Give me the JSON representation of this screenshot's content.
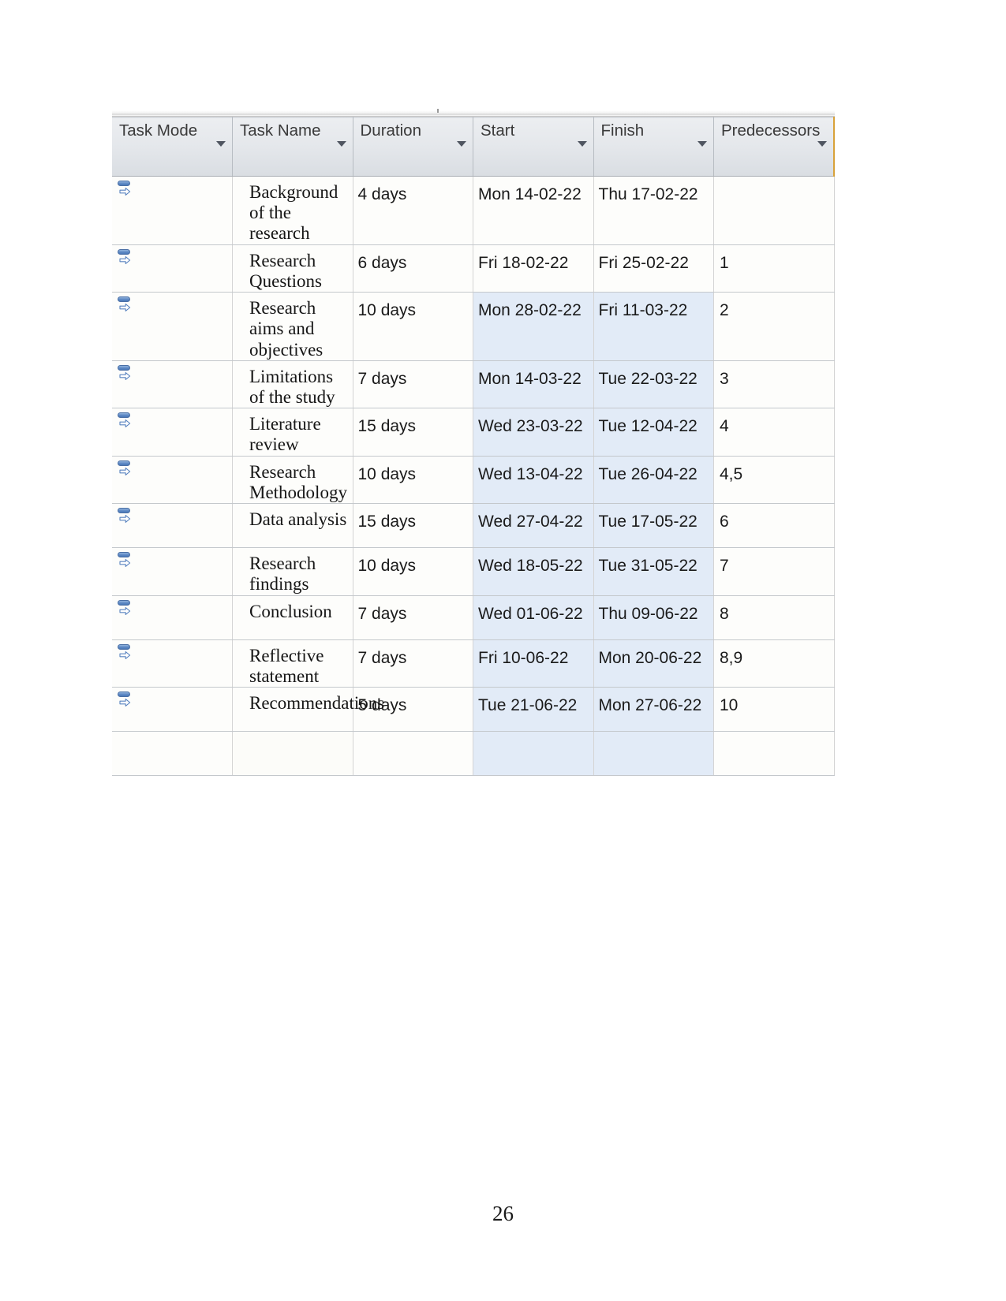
{
  "document": {
    "page_number": "26"
  },
  "grid": {
    "columns": [
      {
        "key": "task_mode",
        "label": "Task Mode",
        "has_filter_arrow": true
      },
      {
        "key": "task_name",
        "label": "Task Name",
        "has_filter_arrow": true
      },
      {
        "key": "duration",
        "label": "Duration",
        "has_filter_arrow": true
      },
      {
        "key": "start",
        "label": "Start",
        "has_filter_arrow": true
      },
      {
        "key": "finish",
        "label": "Finish",
        "has_filter_arrow": true
      },
      {
        "key": "predecessors",
        "label": "Predecessors",
        "has_filter_arrow": true
      }
    ],
    "task_mode_icon": "manually-scheduled-icon",
    "highlight_color": "#e2ebf7",
    "header_accent_color": "#d8a23a",
    "rows": [
      {
        "task_mode_icon": "manually-scheduled-icon",
        "task_name": "Background of the research",
        "duration": "4 days",
        "start": "Mon 14-02-22",
        "finish": "Thu 17-02-22",
        "predecessors": "",
        "highlighted": false
      },
      {
        "task_mode_icon": "manually-scheduled-icon",
        "task_name": "Research Questions",
        "duration": "6 days",
        "start": "Fri 18-02-22",
        "finish": "Fri 25-02-22",
        "predecessors": "1",
        "highlighted": false
      },
      {
        "task_mode_icon": "manually-scheduled-icon",
        "task_name": "Research aims and objectives",
        "duration": "10 days",
        "start": "Mon 28-02-22",
        "finish": "Fri 11-03-22",
        "predecessors": "2",
        "highlighted": true
      },
      {
        "task_mode_icon": "manually-scheduled-icon",
        "task_name": "Limitations of the study",
        "duration": "7 days",
        "start": "Mon 14-03-22",
        "finish": "Tue 22-03-22",
        "predecessors": "3",
        "highlighted": true
      },
      {
        "task_mode_icon": "manually-scheduled-icon",
        "task_name": "Literature review",
        "duration": "15 days",
        "start": "Wed 23-03-22",
        "finish": "Tue 12-04-22",
        "predecessors": "4",
        "highlighted": true
      },
      {
        "task_mode_icon": "manually-scheduled-icon",
        "task_name": "Research Methodology",
        "duration": "10 days",
        "start": "Wed 13-04-22",
        "finish": "Tue 26-04-22",
        "predecessors": "4,5",
        "highlighted": true
      },
      {
        "task_mode_icon": "manually-scheduled-icon",
        "task_name": "Data analysis",
        "duration": "15 days",
        "start": "Wed 27-04-22",
        "finish": "Tue 17-05-22",
        "predecessors": "6",
        "highlighted": true
      },
      {
        "task_mode_icon": "manually-scheduled-icon",
        "task_name": "Research findings",
        "duration": "10 days",
        "start": "Wed 18-05-22",
        "finish": "Tue 31-05-22",
        "predecessors": "7",
        "highlighted": true
      },
      {
        "task_mode_icon": "manually-scheduled-icon",
        "task_name": "Conclusion",
        "duration": "7 days",
        "start": "Wed 01-06-22",
        "finish": "Thu 09-06-22",
        "predecessors": "8",
        "highlighted": true
      },
      {
        "task_mode_icon": "manually-scheduled-icon",
        "task_name": "Reflective statement",
        "duration": "7 days",
        "start": "Fri 10-06-22",
        "finish": "Mon 20-06-22",
        "predecessors": "8,9",
        "highlighted": true
      },
      {
        "task_mode_icon": "manually-scheduled-icon",
        "task_name": "Recommendations",
        "duration": "5 days",
        "start": "Tue 21-06-22",
        "finish": "Mon 27-06-22",
        "predecessors": "10",
        "highlighted": true
      }
    ]
  }
}
